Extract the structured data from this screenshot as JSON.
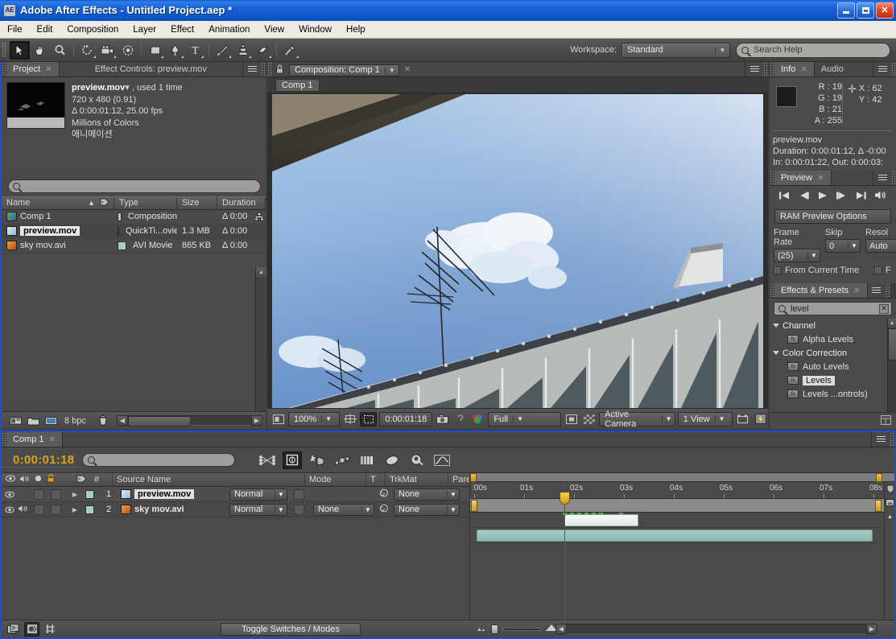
{
  "window": {
    "title": "Adobe After Effects - Untitled Project.aep *",
    "app_abbrev": "AE",
    "minimize": "_",
    "maximize": "□",
    "close": "✕"
  },
  "menubar": {
    "items": [
      "File",
      "Edit",
      "Composition",
      "Layer",
      "Effect",
      "Animation",
      "View",
      "Window",
      "Help"
    ]
  },
  "toolbar": {
    "tools": [
      {
        "name": "selection-tool",
        "label": "Selection"
      },
      {
        "name": "hand-tool",
        "label": "Hand"
      },
      {
        "name": "zoom-tool",
        "label": "Zoom"
      },
      {
        "name": "rotation-tool",
        "label": "Rotation"
      },
      {
        "name": "camera-tool",
        "label": "Camera"
      },
      {
        "name": "pan-behind-tool",
        "label": "Pan Behind"
      },
      {
        "name": "shape-tool",
        "label": "Rectangle"
      },
      {
        "name": "pen-tool",
        "label": "Pen"
      },
      {
        "name": "text-tool",
        "label": "Type"
      },
      {
        "name": "brush-tool",
        "label": "Brush"
      },
      {
        "name": "clone-stamp-tool",
        "label": "Clone Stamp"
      },
      {
        "name": "eraser-tool",
        "label": "Eraser"
      },
      {
        "name": "puppet-pin-tool",
        "label": "Puppet Pin"
      }
    ],
    "workspace_label": "Workspace:",
    "workspace_value": "Standard",
    "search_help_placeholder": "Search Help"
  },
  "project_panel": {
    "tabs": [
      {
        "label": "Project",
        "active": true,
        "closable": true
      },
      {
        "label": "Effect Controls: preview.mov",
        "active": false,
        "closable": false
      }
    ],
    "selected_item": {
      "name": "preview.mov",
      "used": ", used 1 time",
      "dimensions": "720 x 480 (0.91)",
      "duration": "Δ 0:00:01:12, 25.00 fps",
      "depth": "Millions of Colors",
      "comment": "애니메이션"
    },
    "search_placeholder": "",
    "columns": [
      "Name",
      "Type",
      "Size",
      "Duration"
    ],
    "rows": [
      {
        "name": "Comp 1",
        "type": "Composition",
        "size": "",
        "duration": "Δ 0:00",
        "icon": "composition-icon",
        "selected": false
      },
      {
        "name": "preview.mov",
        "type": "QuickTi...ovie",
        "size": "1.3 MB",
        "duration": "Δ 0:00",
        "icon": "quicktime-icon",
        "selected": true
      },
      {
        "name": "sky mov.avi",
        "type": "AVI Movie",
        "size": "865 KB",
        "duration": "Δ 0:00",
        "icon": "avi-icon",
        "selected": false
      }
    ],
    "footer": {
      "bpc": "8 bpc",
      "icons": [
        "interpret-footage-icon",
        "new-folder-icon",
        "new-composition-icon",
        "delete-icon"
      ]
    }
  },
  "composition_panel": {
    "tab_label": "Composition: Comp 1",
    "breadcrumb": "Comp 1",
    "footer": {
      "magnification": "100%",
      "time": "0:00:01:18",
      "resolution": "Full",
      "camera": "Active Camera",
      "views": "1 View",
      "icons": [
        "region-of-interest-icon",
        "toggle-mask-icon",
        "grid-icon",
        "snapshot-icon",
        "show-snapshot-icon",
        "channel-icon",
        "transparency-grid-icon",
        "comp-flowchart-icon",
        "fast-previews-icon"
      ]
    }
  },
  "info_panel": {
    "tabs": [
      {
        "label": "Info",
        "active": true,
        "closable": true
      },
      {
        "label": "Audio",
        "active": false,
        "closable": false
      }
    ],
    "r": "R : 19",
    "g": "G : 19",
    "b": "B : 21",
    "a": "A : 255",
    "x": "X : 62",
    "y": "Y : 42",
    "file_name": "preview.mov",
    "duration_line": "Duration: 0:00:01:12, Δ -0:00",
    "inout_line": "In: 0:00:01:22, Out: 0:00:03:"
  },
  "preview_panel": {
    "tab_label": "Preview",
    "transport": [
      "first-frame-icon",
      "previous-frame-icon",
      "play-icon",
      "next-frame-icon",
      "last-frame-icon",
      "audio-icon"
    ],
    "ram_preview_options": "RAM Preview Options",
    "frame_rate_label": "Frame Rate",
    "frame_rate_value": "(25)",
    "skip_label": "Skip",
    "skip_value": "0",
    "resolution_label": "Resol",
    "resolution_value": "Auto",
    "from_current_time": "From Current Time",
    "full_screen": "F"
  },
  "effects_panel": {
    "tab_label": "Effects & Presets",
    "search_value": "level",
    "clear_icon": "✕",
    "items": [
      {
        "label": "Channel",
        "type": "category"
      },
      {
        "label": "Alpha Levels",
        "type": "effect",
        "selected": false
      },
      {
        "label": "Color Correction",
        "type": "category"
      },
      {
        "label": "Auto Levels",
        "type": "effect",
        "selected": false
      },
      {
        "label": "Levels",
        "type": "effect",
        "selected": true
      },
      {
        "label": "Levels ...ontrols)",
        "type": "effect",
        "selected": false
      }
    ]
  },
  "timeline_panel": {
    "tab_label": "Comp 1",
    "current_time": "0:00:01:18",
    "search_placeholder": "",
    "toolbar_icons": [
      "live-update-icon",
      "draft-3d-icon",
      "hide-shy-layers-icon",
      "frame-blending-icon",
      "motion-blur-icon",
      "brainstorm-icon",
      "graph-editor-icon"
    ],
    "columns": [
      "#",
      "Source Name",
      "Mode",
      "T",
      "TrkMat",
      "Parent"
    ],
    "switch_icons": [
      "video-icon",
      "audio-icon",
      "solo-icon",
      "lock-icon",
      "label-icon"
    ],
    "layers": [
      {
        "index": "1",
        "name": "preview.mov",
        "mode": "Normal",
        "trkmat": "",
        "parent": "None",
        "selected": true,
        "has_audio": false,
        "bar_start_pct": 20.5,
        "bar_width_pct": 30.5,
        "bar_style": "a"
      },
      {
        "index": "2",
        "name": "sky mov.avi",
        "mode": "Normal",
        "trkmat": "None",
        "parent": "None",
        "selected": false,
        "has_audio": true,
        "bar_start_pct": 1.5,
        "bar_width_pct": 95.0,
        "bar_style": "b"
      }
    ],
    "ruler_ticks": [
      ":00s",
      "01s",
      "02s",
      "03s",
      "04s",
      "05s",
      "06s",
      "07s",
      "08s"
    ],
    "playhead_pct": 21.5,
    "footer": {
      "toggle_switches_modes": "Toggle Switches / Modes",
      "icons": [
        "comp-flowchart-icon",
        "comp-mini-flowchart-icon",
        "hide-shy-icon"
      ]
    }
  },
  "colors": {
    "accent_blue": "#1b4fd0",
    "time_orange": "#d8a31e",
    "playhead_red": "#e02020",
    "panel_bg": "#4a4a4a",
    "tab_bg": "#3c3c3c"
  }
}
